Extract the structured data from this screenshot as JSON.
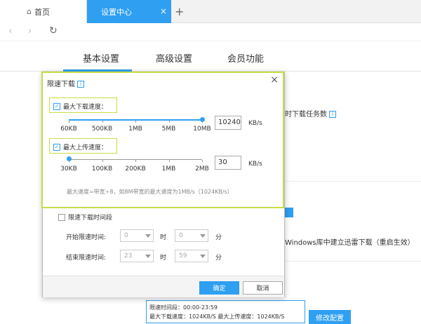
{
  "tabs": {
    "home_label": "首页",
    "active_label": "设置中心",
    "close": "×",
    "add": "+"
  },
  "nav": {
    "back": "‹",
    "forward": "›",
    "reload": "↻"
  },
  "sections": [
    "基本设置",
    "高级设置",
    "会员功能"
  ],
  "background": {
    "task_count_label": "时下载任务数",
    "windows_label": "Windows库中建立迅雷下载（重启生效）",
    "status": {
      "line1": "限速时间段：00:00-23:59",
      "line2": "最大下载速度：1024KB/S  最大上传速度：1024KB/S",
      "button": "修改配置"
    }
  },
  "dialog": {
    "title": "限速下载",
    "info_icon": "i",
    "close": "×",
    "download": {
      "label": "最大下载速度：",
      "checked": true,
      "value": "10240",
      "unit": "KB/s",
      "ticks": [
        "60KB",
        "500KB",
        "1MB",
        "5MB",
        "10MB"
      ],
      "level_fraction": 1.0
    },
    "upload": {
      "label": "最大上传速度：",
      "checked": true,
      "value": "30",
      "unit": "KB/s",
      "ticks": [
        "30KB",
        "100KB",
        "200KB",
        "1MB",
        "2MB"
      ],
      "level_fraction": 0.0
    },
    "hint": "最大速度=带宽÷8，如8M带宽的最大速度为1MB/s（1024KB/s）",
    "schedule": {
      "label": "限速下载时间段",
      "checked": false,
      "start_label": "开始限速时间:",
      "end_label": "结束限速时间:",
      "start_hour": "0",
      "start_min": "0",
      "end_hour": "23",
      "end_min": "59",
      "hour_unit": "时",
      "min_unit": "分"
    },
    "ok": "确定",
    "cancel": "取消"
  },
  "colors": {
    "accent": "#2f9ff2",
    "highlight": "#c8dc46"
  }
}
